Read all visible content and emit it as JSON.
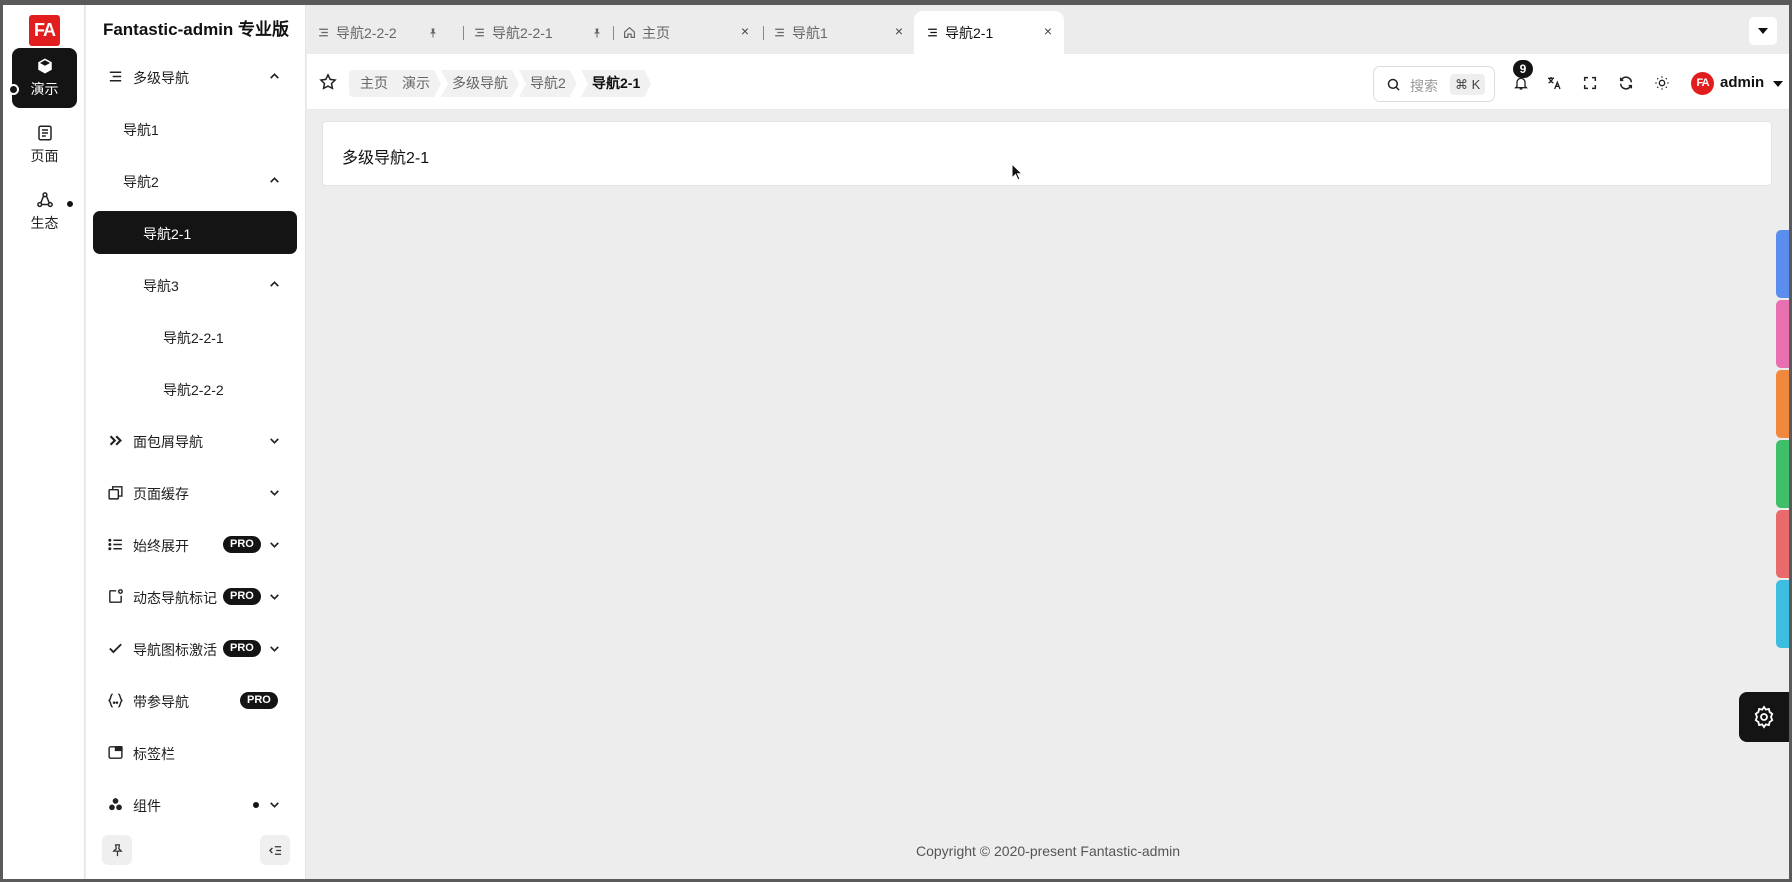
{
  "app": {
    "logo_text": "FA",
    "title": "Fantastic-admin 专业版"
  },
  "main_nav": [
    {
      "label": "演示",
      "icon": "cube-icon",
      "active": true
    },
    {
      "label": "页面",
      "icon": "page-icon",
      "active": false
    },
    {
      "label": "生态",
      "icon": "ecosystem-icon",
      "active": false
    }
  ],
  "sub_nav": {
    "items": [
      {
        "label": "多级导航",
        "expanded": true
      },
      {
        "label": "导航1"
      },
      {
        "label": "导航2",
        "expanded": true
      },
      {
        "label": "导航2-1",
        "active": true
      },
      {
        "label": "导航3",
        "expanded": true
      },
      {
        "label": "导航2-2-1"
      },
      {
        "label": "导航2-2-2"
      },
      {
        "label": "面包屑导航"
      },
      {
        "label": "页面缓存"
      },
      {
        "label": "始终展开",
        "badge": "PRO"
      },
      {
        "label": "动态导航标记",
        "badge": "PRO"
      },
      {
        "label": "导航图标激活",
        "badge": "PRO"
      },
      {
        "label": "带参导航",
        "badge": "PRO"
      },
      {
        "label": "标签栏"
      },
      {
        "label": "组件"
      }
    ]
  },
  "tabs": [
    {
      "label": "导航2-2-2",
      "pinned": true
    },
    {
      "label": "导航2-2-1",
      "pinned": true
    },
    {
      "label": "主页",
      "closable": true
    },
    {
      "label": "导航1",
      "closable": true
    },
    {
      "label": "导航2-1",
      "closable": true,
      "active": true
    }
  ],
  "breadcrumb": [
    "主页",
    "演示",
    "多级导航",
    "导航2",
    "导航2-1"
  ],
  "toolbar": {
    "search_placeholder": "搜索",
    "search_shortcut": "⌘ K",
    "notification_count": "9",
    "user_name": "admin"
  },
  "content": {
    "title": "多级导航2-1"
  },
  "footer": {
    "text": "Copyright © 2020-present  Fantastic-admin"
  },
  "theme_colors": [
    "#5b8def",
    "#e86fb0",
    "#f0883e",
    "#3fbf6a",
    "#e96a6a",
    "#3dbde0"
  ],
  "accent": "#141414",
  "brand": "#e11d1d"
}
